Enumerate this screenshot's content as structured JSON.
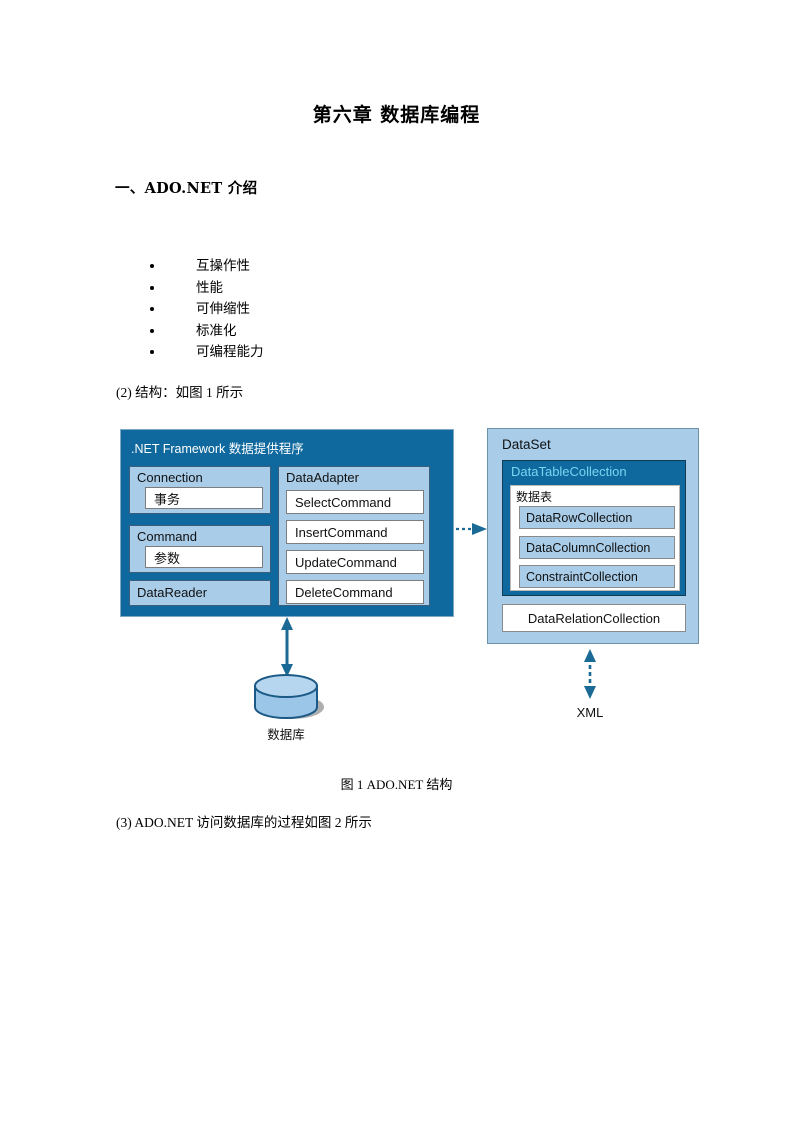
{
  "document": {
    "title": "第六章  数据库编程",
    "section_heading": "一、ADO.NET 介绍",
    "bullets": [
      "互操作性",
      "性能",
      "可伸缩性",
      "标准化",
      "可编程能力"
    ],
    "structure_line": "(2) 结构：如图 1 所示",
    "figure_caption": "图 1 ADO.NET 结构",
    "process_line": "(3) ADO.NET 访问数据库的过程如图 2 所示"
  },
  "diagram": {
    "provider_panel": {
      "title": ".NET Framework 数据提供程序",
      "connection": {
        "label": "Connection",
        "inner": "事务"
      },
      "command": {
        "label": "Command",
        "inner": "参数"
      },
      "datareader": {
        "label": "DataReader"
      },
      "dataadapter": {
        "label": "DataAdapter",
        "commands": [
          "SelectCommand",
          "InsertCommand",
          "UpdateCommand",
          "DeleteCommand"
        ]
      }
    },
    "dataset_panel": {
      "title": "DataSet",
      "datatable_collection": {
        "label": "DataTableCollection",
        "table_label": "数据表",
        "collections": [
          "DataRowCollection",
          "DataColumnCollection",
          "ConstraintCollection"
        ]
      },
      "relation_collection": "DataRelationCollection"
    },
    "database_label": "数据库",
    "xml_label": "XML",
    "colors": {
      "panel_dark_blue": "#10699e",
      "box_light_blue": "#a9cce8",
      "dtc_title_cyan": "#79d4f0",
      "arrow_blue": "#1b6a96",
      "cylinder_fill": "#9cc6e8",
      "cylinder_stroke": "#1b5a86"
    }
  }
}
